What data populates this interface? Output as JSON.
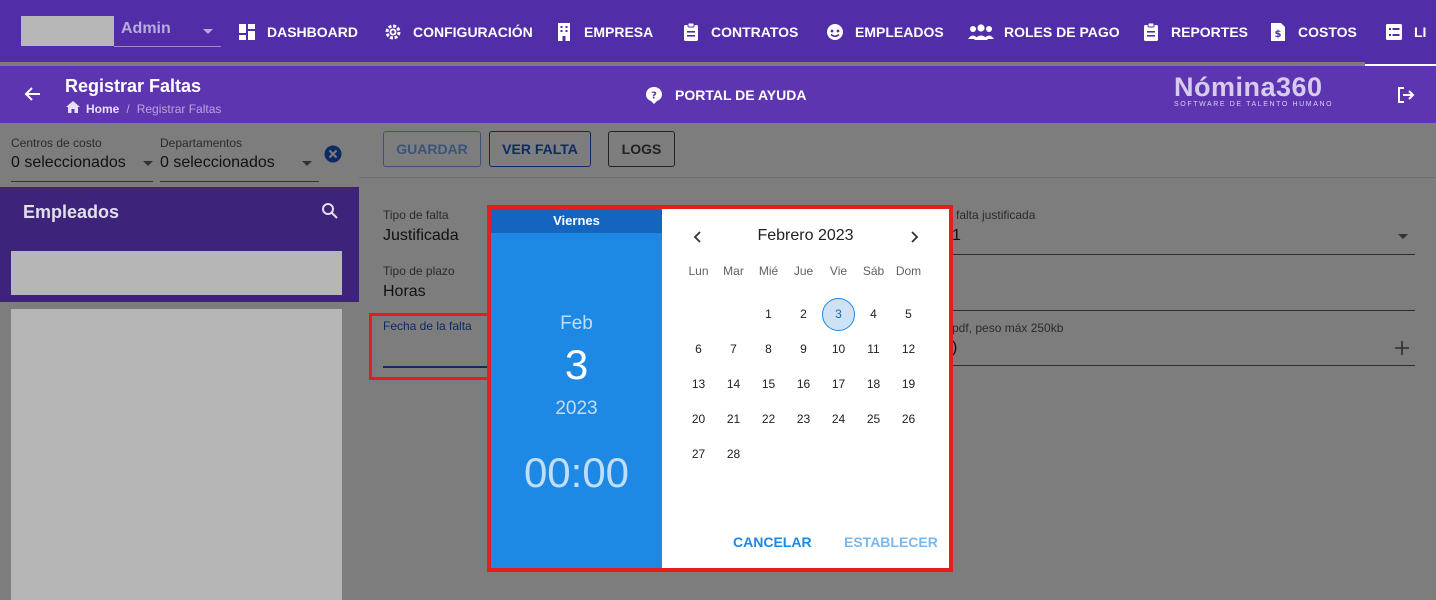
{
  "topnav": {
    "user_label": "Admin",
    "items": [
      {
        "label": "DASHBOARD",
        "icon": "dashboard-icon"
      },
      {
        "label": "CONFIGURACIÓN",
        "icon": "gear-icon"
      },
      {
        "label": "EMPRESA",
        "icon": "building-icon"
      },
      {
        "label": "CONTRATOS",
        "icon": "clipboard-icon"
      },
      {
        "label": "EMPLEADOS",
        "icon": "face-icon"
      },
      {
        "label": "ROLES DE PAGO",
        "icon": "group-icon"
      },
      {
        "label": "REPORTES",
        "icon": "clipboard-icon"
      },
      {
        "label": "COSTOS",
        "icon": "invoice-icon"
      },
      {
        "label": "LI",
        "icon": "list-icon"
      }
    ]
  },
  "subheader": {
    "title": "Registrar Faltas",
    "breadcrumb_home": "Home",
    "breadcrumb_sep": "/",
    "breadcrumb_current": "Registrar Faltas",
    "help_label": "PORTAL DE AYUDA",
    "brand_name": "Nómina360",
    "brand_tagline": "SOFTWARE DE TALENTO HUMANO"
  },
  "filters": {
    "cost_centers_label": "Centros de costo",
    "cost_centers_value": "0 seleccionados",
    "departments_label": "Departamentos",
    "departments_value": "0 seleccionados"
  },
  "employees": {
    "title": "Empleados"
  },
  "toolbar": {
    "save_label": "GUARDAR",
    "view_label": "VER FALTA",
    "logs_label": "LOGS"
  },
  "form": {
    "absence_type_label": "Tipo de falta",
    "absence_type_value": "Justificada",
    "term_type_label": "Tipo de plazo",
    "term_type_value": "Horas",
    "date_label": "Fecha de la falta",
    "justified_label": "falta justificada",
    "justified_value": "1",
    "file_label": "pdf, peso máx 250kb",
    "file_value": ")"
  },
  "datepicker": {
    "weekday_name": "Viernes",
    "month_short": "Feb",
    "day": "3",
    "year": "2023",
    "time": "00:00",
    "month_title": "Febrero 2023",
    "weekdays": [
      "Lun",
      "Mar",
      "Mié",
      "Jue",
      "Vie",
      "Sáb",
      "Dom"
    ],
    "days": [
      "1",
      "2",
      "3",
      "4",
      "5",
      "6",
      "7",
      "8",
      "9",
      "10",
      "11",
      "12",
      "13",
      "14",
      "15",
      "16",
      "17",
      "18",
      "19",
      "20",
      "21",
      "22",
      "23",
      "24",
      "25",
      "26",
      "27",
      "28"
    ],
    "first_weekday_index": 2,
    "selected_day": 3,
    "cancel_label": "CANCELAR",
    "set_label": "ESTABLECER",
    "accent_color": "#1e88e5"
  },
  "colors": {
    "nav_bg": "#512da8",
    "subheader_bg": "#5e35b1",
    "highlight": "#e02020"
  }
}
